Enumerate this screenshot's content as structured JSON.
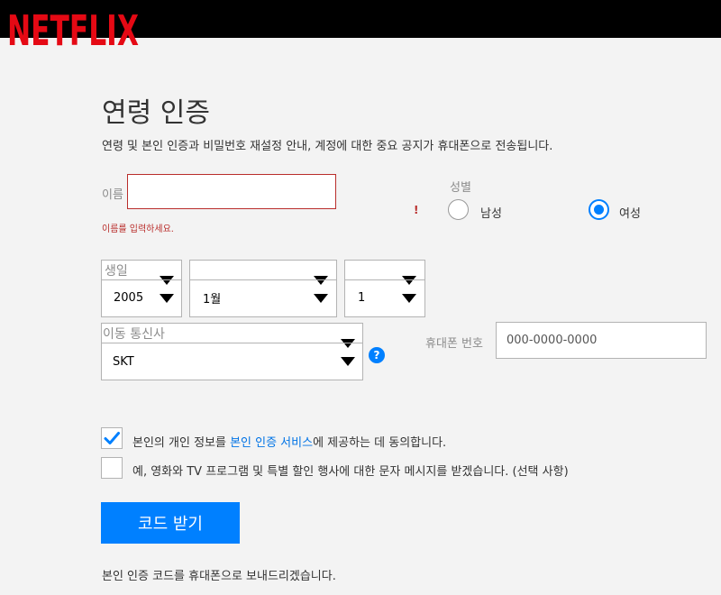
{
  "header": {
    "logo_text": "NETFLIX",
    "logo_color": "#e50914"
  },
  "page": {
    "title": "연령 인증",
    "subtitle": "연령 및 본인 인증과 비밀번호 재설정 안내, 계정에 대한 중요 공지가 휴대폰으로 전송됩니다."
  },
  "form": {
    "name": {
      "label": "이름",
      "value": "",
      "error": "이름를 입력하세요.",
      "error_mark": "!"
    },
    "gender": {
      "label": "성별",
      "options": [
        {
          "label": "남성",
          "selected": false
        },
        {
          "label": "여성",
          "selected": true
        }
      ]
    },
    "birth": {
      "label": "생일",
      "year": "2005",
      "month": "1월",
      "day": "1"
    },
    "carrier": {
      "label": "이동 통신사",
      "value": "SKT",
      "help_icon": "help-icon",
      "help_glyph": "?"
    },
    "phone": {
      "label": "휴대폰 번호",
      "placeholder": "000-0000-0000",
      "value": ""
    },
    "consent": {
      "checked": true,
      "text_before": "본인의 개인 정보를 ",
      "link_text": "본인 인증 서비스",
      "text_after": "에 제공하는 데 동의합니다."
    },
    "marketing": {
      "checked": false,
      "text": "예, 영화와 TV 프로그램 및 특별 할인 행사에 대한 문자 메시지를 받겠습니다. (선택 사항)"
    },
    "submit_label": "코드 받기",
    "footer_note": "본인 인증 코드를 휴대폰으로 보내드리겠습니다."
  },
  "colors": {
    "accent": "#0080ff",
    "error": "#b92d2b",
    "background": "#f3f3f3"
  }
}
